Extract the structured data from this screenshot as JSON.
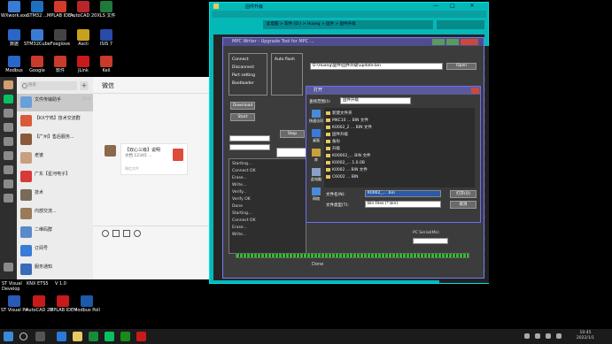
{
  "desktop": {
    "left_icons": [
      {
        "label": "WXwork.exe",
        "color": "#3a7bd5"
      },
      {
        "label": "STM32 ...",
        "color": "#1f6fbf"
      },
      {
        "label": "MPLAB IDE v8.92",
        "color": "#d43a2a"
      },
      {
        "label": "AutoCAD 2022",
        "color": "#b8262c"
      },
      {
        "label": "XLS 文件",
        "color": "#1d7a3a"
      },
      {
        "label": "数据",
        "color": "#2a66c8"
      },
      {
        "label": "STM32CubeMX",
        "color": "#3a7bd5"
      },
      {
        "label": "Foxglove",
        "color": "#444"
      },
      {
        "label": "Ascii",
        "color": "#c8a020"
      },
      {
        "label": "ISIS 7",
        "color": "#2a4aa8"
      },
      {
        "label": "Modbus",
        "color": "#2a66c8"
      },
      {
        "label": "Google",
        "color": "#c83a2a"
      },
      {
        "label": "软件",
        "color": "#c83a2a"
      },
      {
        "label": "JLink",
        "color": "#c81a1a"
      },
      {
        "label": "Keil",
        "color": "#c83a2a"
      }
    ],
    "bottom_labels": [
      "ST Visual Develop",
      "KNX ETS5",
      "V 1.0"
    ],
    "bottom_icons": [
      {
        "label": "ST Visual Programmer",
        "color": "#2a5ab8"
      },
      {
        "label": "AutoCAD 2022 - 简体中文",
        "color": "#c81a1a"
      },
      {
        "label": "MPLAB IDE v8.92",
        "color": "#c81a1a"
      },
      {
        "label": "Modbus Poll",
        "color": "#1a5aa8"
      }
    ]
  },
  "chat": {
    "search_placeholder": "搜索",
    "header_title": "微信",
    "items": [
      {
        "name": "文件传输助手",
        "preview": "",
        "time": "10:4",
        "color": "#6a9fd8"
      },
      {
        "name": "【KX宁鸣】技术交流群",
        "preview": "",
        "time": "",
        "color": "#d85a3a"
      },
      {
        "name": "【广州】售后服务...",
        "preview": "",
        "time": "",
        "color": "#8a5a3a"
      },
      {
        "name": "老婆",
        "preview": "",
        "time": "",
        "color": "#c8a080"
      },
      {
        "name": "广东【星河电子】",
        "preview": "",
        "time": "",
        "color": "#d83a3a"
      },
      {
        "name": "技术",
        "preview": "",
        "time": "",
        "color": "#7a6a5a"
      },
      {
        "name": "内部交流...",
        "preview": "",
        "time": "",
        "color": "#9a7a5a"
      },
      {
        "name": "二维码群",
        "preview": "",
        "time": "",
        "color": "#5a8ac8"
      },
      {
        "name": "订阅号",
        "preview": "",
        "time": "",
        "color": "#3a7ad8"
      },
      {
        "name": "服务通知",
        "preview": "",
        "time": "",
        "color": "#3a6ab8"
      }
    ],
    "shared_card": {
      "title": "【双心三级】说明",
      "subtitle": "文档 12345 ...",
      "source": "微信文件"
    }
  },
  "explorer": {
    "title": "固件升级",
    "path": "此电脑 > 软件 (D:) > Huang > 固件 > 固件升级",
    "window_controls": [
      "—",
      "□",
      "✕"
    ]
  },
  "app": {
    "title": "MPC Writer - Upgrade Tool for MPC ...",
    "group1": [
      "Connect",
      "Disconnect",
      "Port setting",
      "Bootloader"
    ],
    "group2": [
      "Auto flash"
    ],
    "file_path": "D:\\Huang\\固件\\固件升级\\update.bin",
    "buttons": [
      "Open",
      "Download",
      "Start",
      "Stop"
    ],
    "log_lines": [
      "Starting...",
      "Connect OK",
      "Erase...",
      "Write...",
      "Verify...",
      "Verify OK",
      "Done",
      "Starting...",
      "Connect OK",
      "Erase...",
      "Write..."
    ],
    "status": "Done",
    "serial_label": "PC Serial(Ms)"
  },
  "dialog": {
    "title": "打开",
    "look_in_label": "查找范围(I):",
    "look_in_value": "固件升级",
    "places": [
      "快速访问",
      "桌面",
      "库",
      "此电脑",
      "网络"
    ],
    "files": [
      "新建文件夹",
      "MKC10 ... BIN 文件",
      "K0002_2 ... BIN 文件",
      "固件升级",
      "备份",
      "升级",
      "K00002_... BIN 文件",
      "K0002_... 1.0.0B",
      "K0002 ... BIN 文件",
      "C6002 ... BIN"
    ],
    "filename_label": "文件名(N):",
    "filename_value": "K0002_... .bin",
    "filetype_label": "文件类型(T):",
    "filetype_value": "Bin Files (*.bin)",
    "open_button": "打开(O)",
    "cancel_button": "取消"
  },
  "taskbar": {
    "search_icon": "search-icon",
    "time": "10:45",
    "date": "2022/1/1"
  }
}
